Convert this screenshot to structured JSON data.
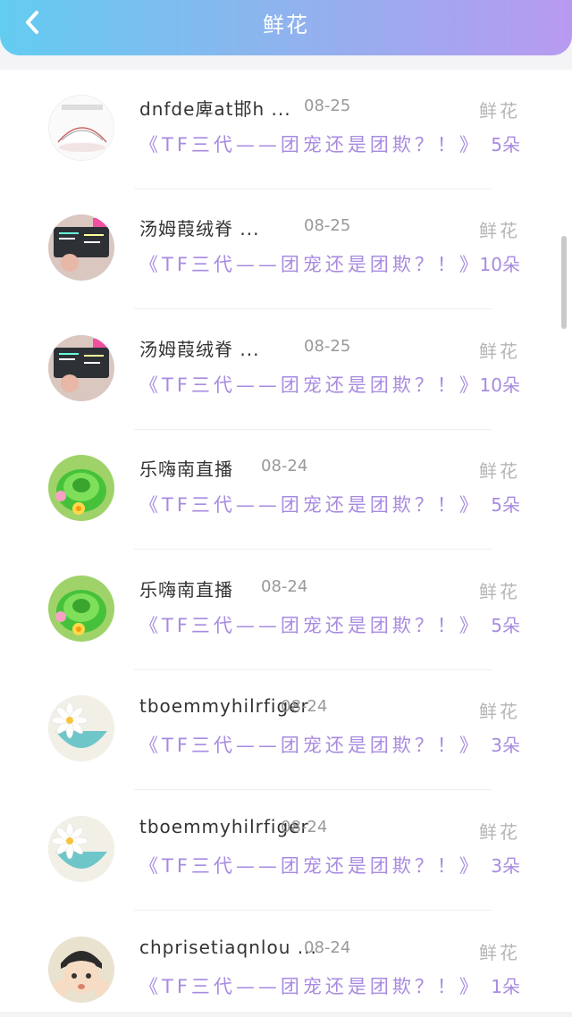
{
  "header": {
    "title": "鲜花",
    "back_icon": "chevron-left-icon"
  },
  "rows": [
    {
      "name": "dnfde庳at邯h ...",
      "date": "08-25",
      "post": "《TF三代——团宠还是团欺？！》",
      "type": "鲜花",
      "count": "5朵",
      "avatar": "avatar-bed-sketch"
    },
    {
      "name": "汤姆葭绒脊 ...",
      "date": "08-25",
      "post": "《TF三代——团宠还是团欺？！》",
      "type": "鲜花",
      "count": "10朵",
      "avatar": "avatar-book-hand"
    },
    {
      "name": "汤姆葭绒脊 ...",
      "date": "08-25",
      "post": "《TF三代——团宠还是团欺？！》",
      "type": "鲜花",
      "count": "10朵",
      "avatar": "avatar-book-hand"
    },
    {
      "name": "乐嗨南直播",
      "date": "08-24",
      "post": "《TF三代——团宠还是团欺？！》",
      "type": "鲜花",
      "count": "5朵",
      "avatar": "avatar-green-coil"
    },
    {
      "name": "乐嗨南直播",
      "date": "08-24",
      "post": "《TF三代——团宠还是团欺？！》",
      "type": "鲜花",
      "count": "5朵",
      "avatar": "avatar-green-coil"
    },
    {
      "name": "tboemmyhilrfiger",
      "date": "08-24",
      "post": "《TF三代——团宠还是团欺？！》",
      "type": "鲜花",
      "count": "3朵",
      "avatar": "avatar-daisy-cup"
    },
    {
      "name": "tboemmyhilrfiger",
      "date": "08-24",
      "post": "《TF三代——团宠还是团欺？！》",
      "type": "鲜花",
      "count": "3朵",
      "avatar": "avatar-daisy-cup"
    },
    {
      "name": "chprisetiaqnlou ...",
      "date": "08-24",
      "post": "《TF三代——团宠还是团欺？！》",
      "type": "鲜花",
      "count": "1朵",
      "avatar": "avatar-anime-boy"
    }
  ],
  "colors": {
    "header_start": "#63ccf1",
    "header_end": "#b89af0",
    "accent_purple": "#a88be0"
  }
}
